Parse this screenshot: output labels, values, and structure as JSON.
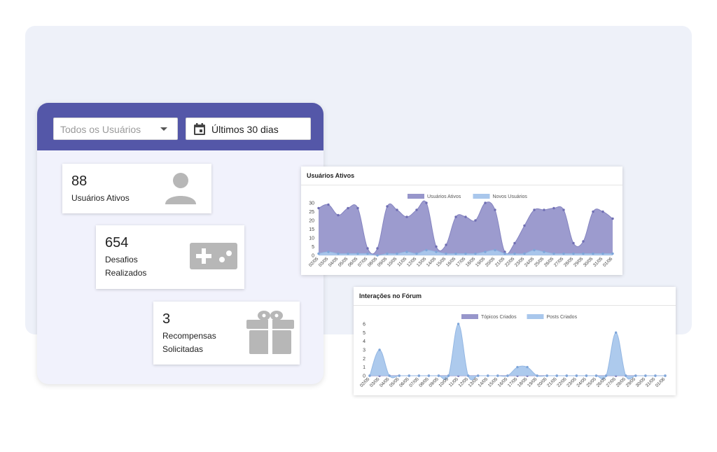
{
  "filters": {
    "user_select": "Todos os Usuários",
    "date_range": "Últimos 30 dias"
  },
  "stats": {
    "active_users": {
      "value": "88",
      "label": "Usuários Ativos",
      "icon": "person-icon"
    },
    "challenges": {
      "value": "654",
      "label_line1": "Desafios",
      "label_line2": "Realizados",
      "icon": "gamepad-icon"
    },
    "rewards": {
      "value": "3",
      "label_line1": "Recompensas",
      "label_line2": "Solicitadas",
      "icon": "gift-icon"
    }
  },
  "colors": {
    "header": "#5457a8",
    "series_purple": "#9796cb",
    "series_blue": "#a9c7ec",
    "icon_gray": "#b7b7b7"
  },
  "chart_data": [
    {
      "type": "area",
      "title": "Usuários Ativos",
      "legend_position": "top",
      "x": [
        "02/05",
        "03/05",
        "04/05",
        "05/05",
        "06/05",
        "07/05",
        "08/05",
        "09/05",
        "10/05",
        "11/05",
        "12/05",
        "13/05",
        "14/05",
        "15/05",
        "16/05",
        "17/05",
        "18/05",
        "19/05",
        "20/05",
        "21/05",
        "22/05",
        "23/05",
        "24/05",
        "25/05",
        "26/05",
        "27/05",
        "28/05",
        "29/05",
        "30/05",
        "31/05",
        "01/06"
      ],
      "ylim": [
        0,
        30
      ],
      "yticks": [
        "0",
        "5",
        "10",
        "15",
        "20",
        "25",
        "30"
      ],
      "series": [
        {
          "name": "Usuários Ativos",
          "values": [
            27,
            29,
            23,
            27,
            27,
            4,
            4,
            28,
            26,
            22,
            26,
            30,
            5,
            6,
            22,
            22,
            20,
            30,
            26,
            2,
            7,
            17,
            26,
            26,
            27,
            26,
            7,
            8,
            25,
            25,
            21
          ]
        },
        {
          "name": "Novos Usuários",
          "values": [
            1,
            2,
            1,
            1,
            1,
            1,
            0,
            1,
            1,
            2,
            1,
            3,
            2,
            1,
            1,
            1,
            1,
            2,
            3,
            1,
            1,
            1,
            3,
            2,
            1,
            1,
            1,
            1,
            1,
            1,
            1
          ]
        }
      ]
    },
    {
      "type": "area",
      "title": "Interações no Fórum",
      "legend_position": "top",
      "x": [
        "02/05",
        "03/05",
        "04/05",
        "05/05",
        "06/05",
        "07/05",
        "08/05",
        "09/05",
        "10/05",
        "11/05",
        "12/05",
        "13/05",
        "14/05",
        "15/05",
        "16/05",
        "17/05",
        "18/05",
        "19/05",
        "20/05",
        "21/05",
        "22/05",
        "23/05",
        "24/05",
        "25/05",
        "26/05",
        "27/05",
        "28/05",
        "29/05",
        "30/05",
        "31/05",
        "01/06"
      ],
      "ylim": [
        0,
        6
      ],
      "yticks": [
        "0",
        "1",
        "2",
        "3",
        "4",
        "5",
        "6"
      ],
      "series": [
        {
          "name": "Tópicos Criados",
          "values": [
            0,
            0,
            0,
            0,
            0,
            0,
            0,
            0,
            0,
            0,
            0,
            0,
            0,
            0,
            0,
            0,
            0,
            0,
            0,
            0,
            0,
            0,
            0,
            0,
            0,
            0,
            0,
            0,
            0,
            0,
            0
          ]
        },
        {
          "name": "Posts Criados",
          "values": [
            0,
            3,
            0,
            0,
            0,
            0,
            0,
            0,
            0,
            6,
            0,
            0,
            0,
            0,
            0,
            1,
            1,
            0,
            0,
            0,
            0,
            0,
            0,
            0,
            0,
            5,
            0,
            0,
            0,
            0,
            0
          ]
        }
      ]
    }
  ]
}
